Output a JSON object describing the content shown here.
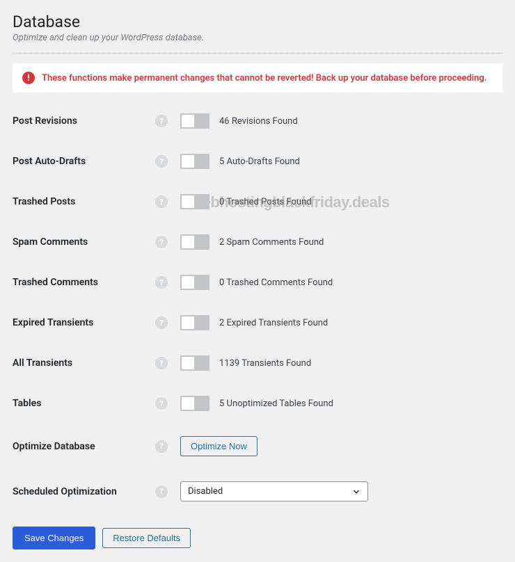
{
  "page": {
    "title": "Database",
    "subtitle": "Optimize and clean up your WordPress database."
  },
  "warning": {
    "text": "These functions make permanent changes that cannot be reverted! Back up your database before proceeding."
  },
  "watermark": "webhostingblackfriday.deals",
  "rows": {
    "post_revisions": {
      "label": "Post Revisions",
      "value": "46 Revisions Found"
    },
    "post_auto_drafts": {
      "label": "Post Auto-Drafts",
      "value": "5 Auto-Drafts Found"
    },
    "trashed_posts": {
      "label": "Trashed Posts",
      "value": "0 Trashed Posts Found"
    },
    "spam_comments": {
      "label": "Spam Comments",
      "value": "2 Spam Comments Found"
    },
    "trashed_comments": {
      "label": "Trashed Comments",
      "value": "0 Trashed Comments Found"
    },
    "expired_transients": {
      "label": "Expired Transients",
      "value": "2 Expired Transients Found"
    },
    "all_transients": {
      "label": "All Transients",
      "value": "1139 Transients Found"
    },
    "tables": {
      "label": "Tables",
      "value": "5 Unoptimized Tables Found"
    },
    "optimize_db": {
      "label": "Optimize Database",
      "button": "Optimize Now"
    },
    "scheduled": {
      "label": "Scheduled Optimization",
      "selected": "Disabled"
    }
  },
  "footer": {
    "save": "Save Changes",
    "restore": "Restore Defaults"
  }
}
